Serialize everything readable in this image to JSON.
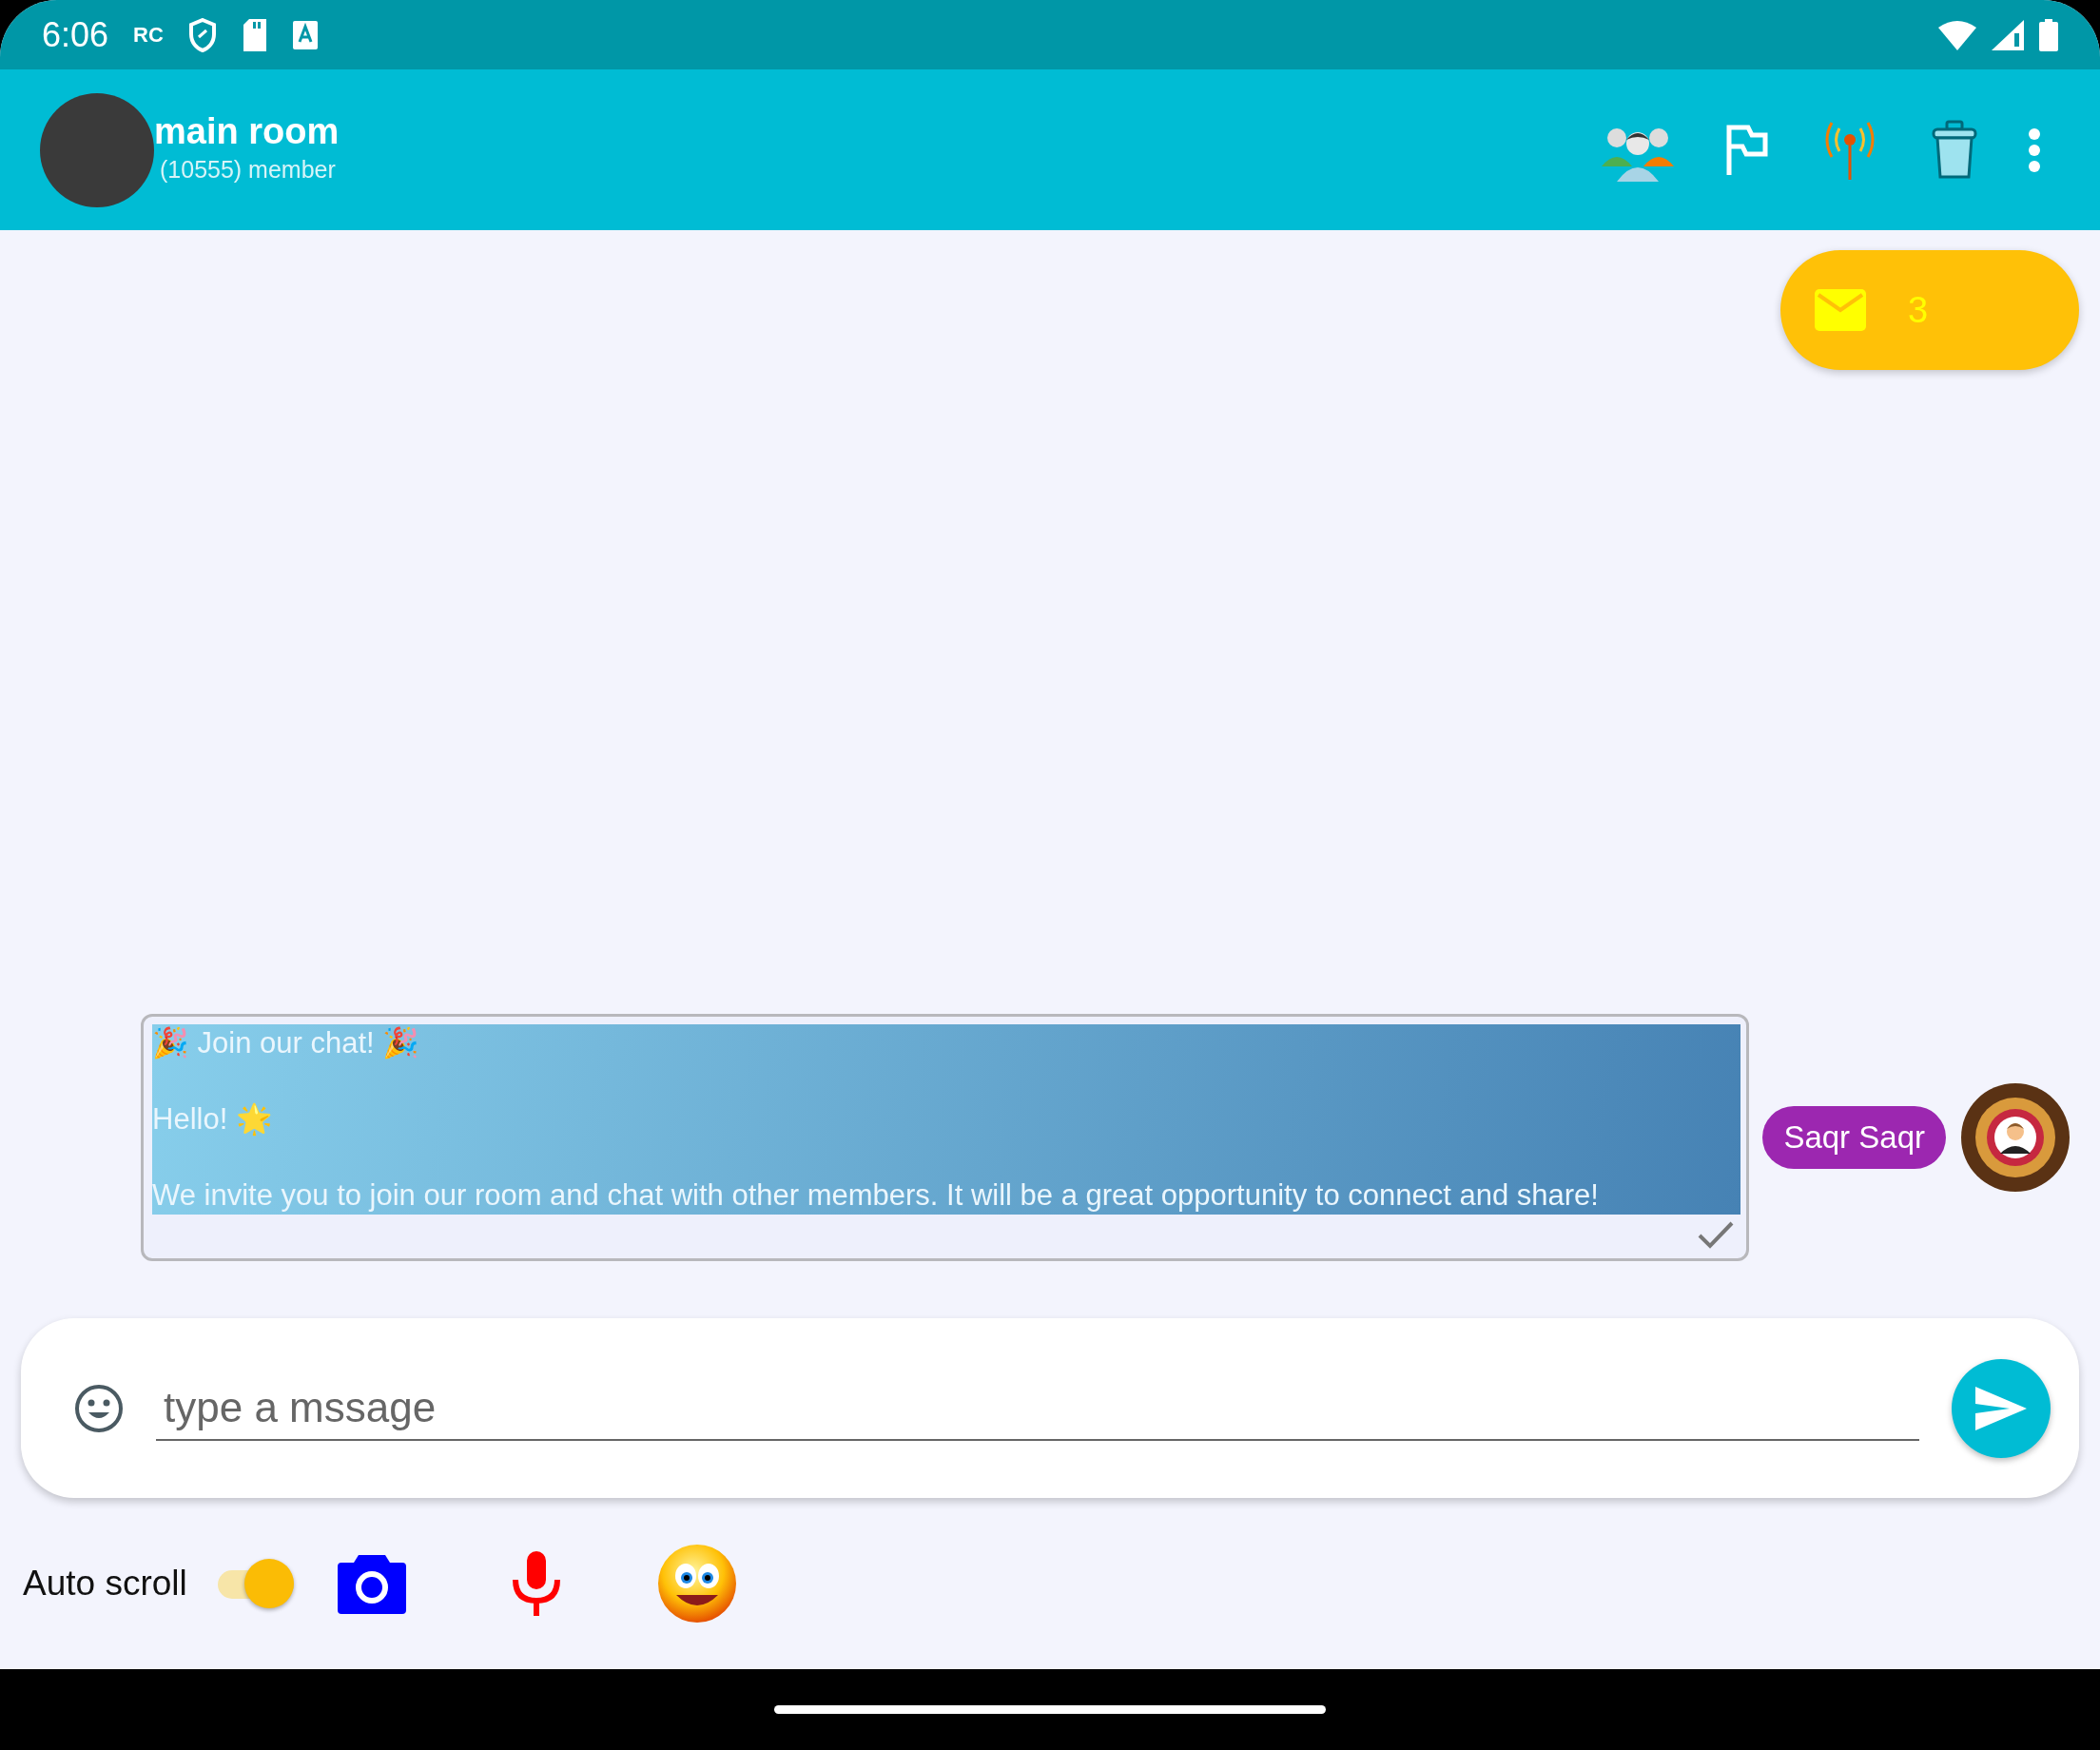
{
  "status_bar": {
    "time": "6:06",
    "carrier": "RC"
  },
  "header": {
    "title": "main room",
    "subtitle": "(10555) member"
  },
  "unread_badge": {
    "count": "3"
  },
  "messages": [
    {
      "paragraphs": [
        "🎉 Join our chat! 🎉",
        "Hello! 🌟",
        "We invite you to join our room and chat with other members. It will be a great opportunity to connect and share!"
      ],
      "sender": "Saqr Saqr",
      "read": true
    }
  ],
  "composer": {
    "placeholder": "type a mssage"
  },
  "toolbar": {
    "auto_scroll_label": "Auto scroll",
    "auto_scroll_on": true
  }
}
